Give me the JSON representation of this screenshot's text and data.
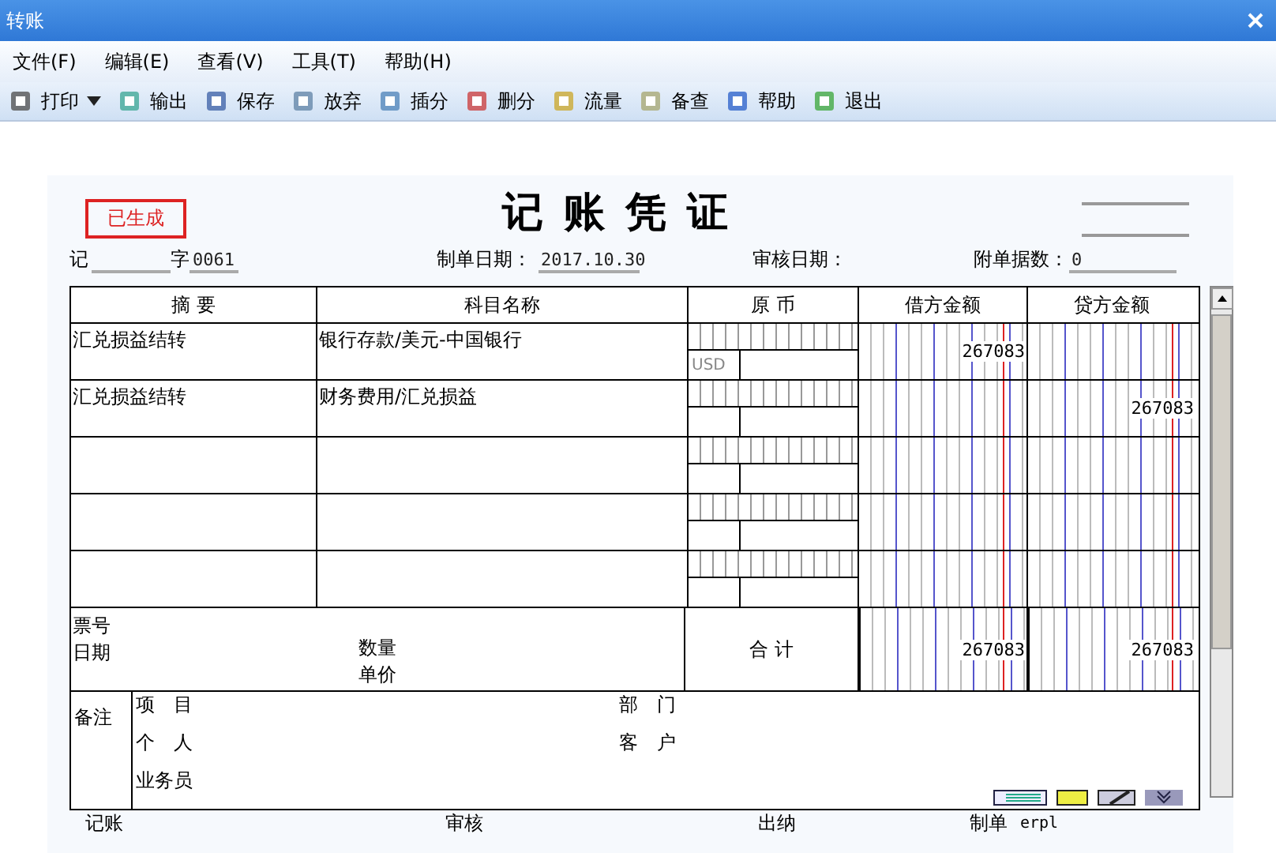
{
  "window": {
    "title": "转账"
  },
  "menu": [
    "文件(F)",
    "编辑(E)",
    "查看(V)",
    "工具(T)",
    "帮助(H)"
  ],
  "toolbar": [
    {
      "label": "打印",
      "has_menu": true
    },
    {
      "label": "输出",
      "has_menu": false
    },
    {
      "label": "保存",
      "has_menu": false
    },
    {
      "label": "放弃",
      "has_menu": false
    },
    {
      "label": "插分",
      "has_menu": false
    },
    {
      "label": "删分",
      "has_menu": false
    },
    {
      "label": "流量",
      "has_menu": false
    },
    {
      "label": "备查",
      "has_menu": false
    },
    {
      "label": "帮助",
      "has_menu": false
    },
    {
      "label": "退出",
      "has_menu": false
    }
  ],
  "voucher": {
    "status_stamp": "已生成",
    "title": "记 账 凭 证",
    "type_label": "记",
    "number_label": "字",
    "number": "0061",
    "date_label": "制单日期：",
    "date": "2017.10.30",
    "audit_date_label": "审核日期：",
    "attachments_label": "附单据数：",
    "attachments": "0",
    "table": {
      "columns": [
        "摘 要",
        "科目名称",
        "原 币",
        "借方金额",
        "贷方金额"
      ],
      "rows": [
        {
          "summary": "汇兑损益结转",
          "account": "银行存款/美元-中国银行",
          "currency": "USD",
          "debit": "267083"
        },
        {
          "summary": "汇兑损益结转",
          "account": "财务费用/汇兑损益",
          "credit": "267083"
        }
      ]
    },
    "totals": {
      "ticket_label": "票号",
      "date_label": "日期",
      "quantity_label": "数量",
      "price_label": "单价",
      "total_label": "合 计",
      "debit": "267083",
      "credit": "267083"
    },
    "notes": {
      "label": "备注",
      "fields": [
        "项　目",
        "部　门",
        "个　人",
        "客　户",
        "业务员"
      ]
    },
    "signatures": [
      {
        "label": "记账"
      },
      {
        "label": "审核"
      },
      {
        "label": "出纳"
      },
      {
        "label": "制单",
        "value": "erpl"
      }
    ]
  }
}
